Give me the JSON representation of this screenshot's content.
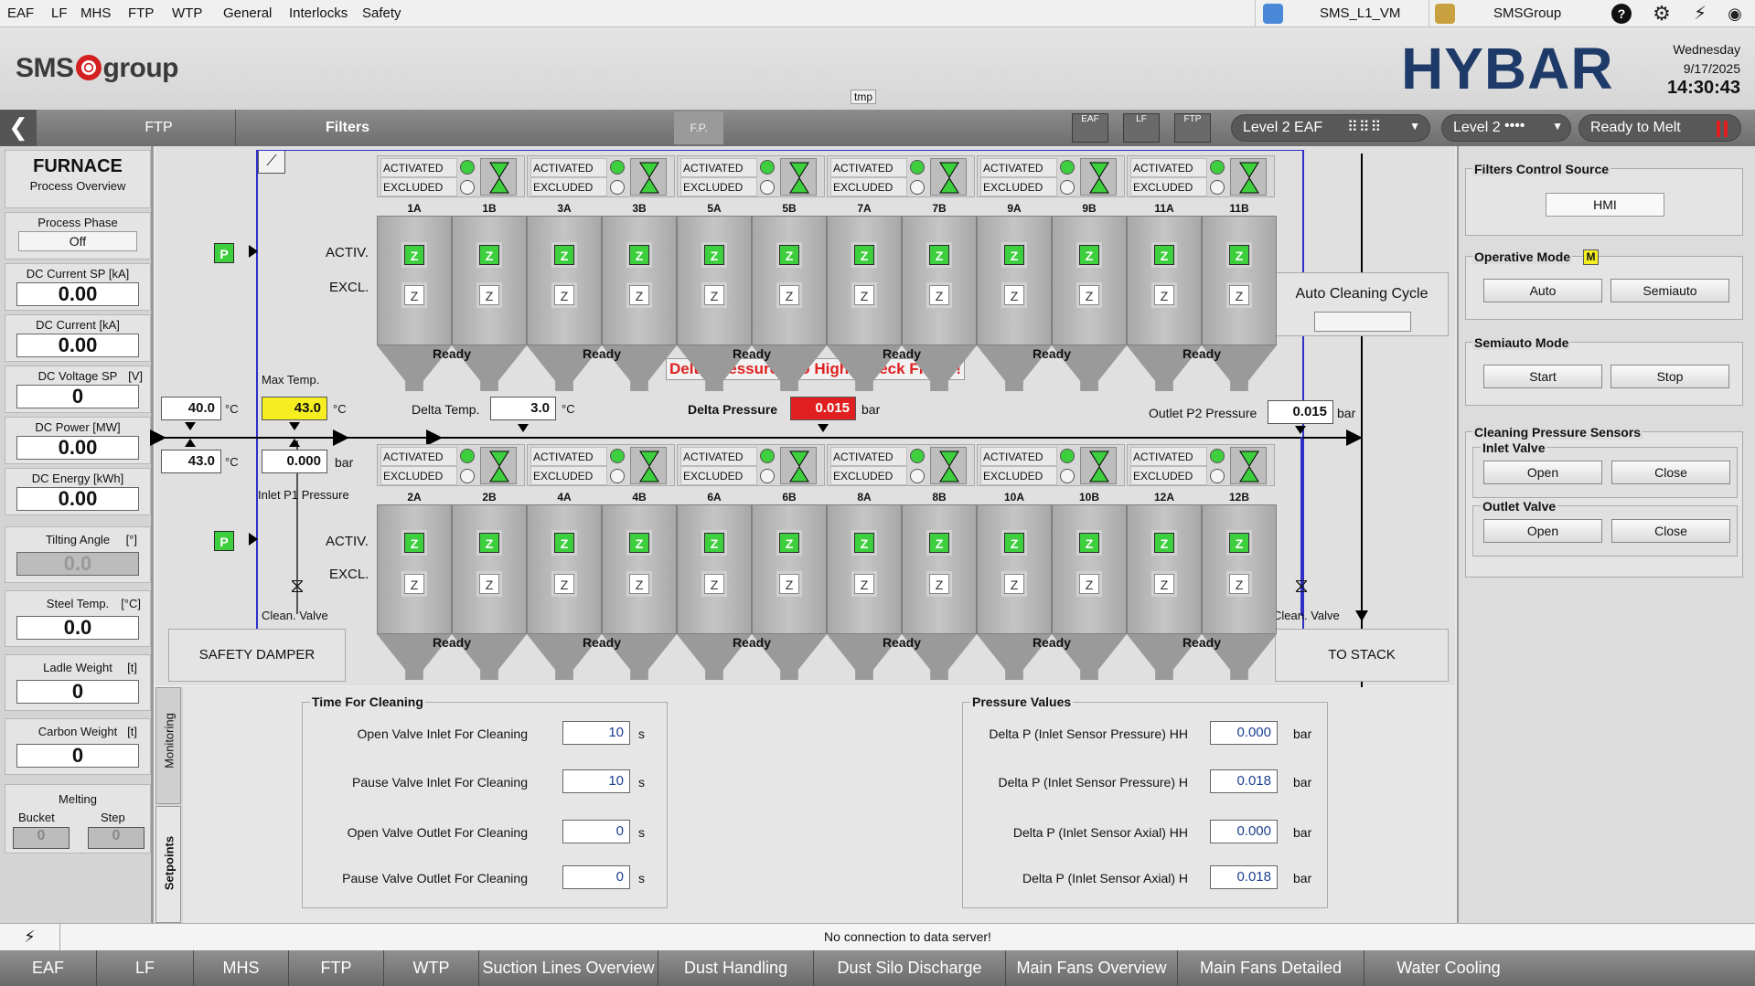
{
  "menu": {
    "items": [
      "EAF",
      "LF",
      "MHS",
      "FTP",
      "WTP",
      "General",
      "Interlocks",
      "Safety"
    ],
    "vm": "SMS_L1_VM",
    "group": "SMSGroup"
  },
  "header": {
    "logo_left": "SMS",
    "logo_right": "group",
    "brand": "HYBAR",
    "day": "Wednesday",
    "date": "9/17/2025",
    "time": "14:30:43",
    "tmp": "tmp"
  },
  "nav": {
    "crumb1": "FTP",
    "crumb2": "Filters",
    "fp": "F.P.",
    "level2_eaf": "Level 2 EAF",
    "level2": "Level 2",
    "ready": "Ready to Melt",
    "icons": [
      "EAF",
      "LF",
      "FTP"
    ]
  },
  "left": {
    "title": "FURNACE",
    "subtitle": "Process Overview",
    "process_phase": {
      "label": "Process Phase",
      "value": "Off"
    },
    "dc_current_sp": {
      "label": "DC Current SP [kA]",
      "value": "0.00"
    },
    "dc_current": {
      "label": "DC Current [kA]",
      "value": "0.00"
    },
    "dc_voltage_sp": {
      "label": "DC Voltage SP",
      "unit": "[V]",
      "value": "0"
    },
    "dc_power": {
      "label": "DC Power [MW]",
      "value": "0.00"
    },
    "dc_energy": {
      "label": "DC Energy [kWh]",
      "value": "0.00"
    },
    "tilting": {
      "label": "Tilting Angle",
      "unit": "[°]",
      "value": "0.0"
    },
    "steel_temp": {
      "label": "Steel Temp.",
      "unit": "[°C]",
      "value": "0.0"
    },
    "ladle": {
      "label": "Ladle Weight",
      "unit": "[t]",
      "value": "0"
    },
    "carbon": {
      "label": "Carbon Weight",
      "unit": "[t]",
      "value": "0"
    },
    "melting": {
      "label": "Melting",
      "bucket": "Bucket",
      "step": "Step",
      "bucket_val": "0",
      "step_val": "0"
    }
  },
  "filters": {
    "activated": "ACTIVATED",
    "excluded": "EXCLUDED",
    "activ": "ACTIV.",
    "excl": "EXCL.",
    "z": "Z",
    "p": "P",
    "ready": "Ready",
    "top_cells": [
      "1A",
      "1B",
      "3A",
      "3B",
      "5A",
      "5B",
      "7A",
      "7B",
      "9A",
      "9B",
      "11A",
      "11B"
    ],
    "bottom_cells": [
      "2A",
      "2B",
      "4A",
      "4B",
      "6A",
      "6B",
      "8A",
      "8B",
      "10A",
      "10B",
      "12A",
      "12B"
    ]
  },
  "process": {
    "alarm": "Delta Pressure Too High! Check Filters!",
    "temp_in_top": "40.0",
    "temp_in_bottom": "43.0",
    "deg_c": "°C",
    "max_temp_label": "Max Temp.",
    "max_temp": "43.0",
    "inlet_p1": "0.000",
    "inlet_p1_label": "Inlet P1 Pressure",
    "bar": "bar",
    "delta_temp_label": "Delta Temp.",
    "delta_temp": "3.0",
    "delta_p_label": "Delta Pressure",
    "delta_p": "0.015",
    "outlet_p2_label": "Outlet P2 Pressure",
    "outlet_p2": "0.015",
    "clean_valve": "Clean. Valve",
    "safety_damper": "SAFETY DAMPER",
    "to_stack": "TO STACK",
    "auto_cleaning": "Auto Cleaning Cycle"
  },
  "right": {
    "control_source_title": "Filters Control Source",
    "control_source": "HMI",
    "operative_title": "Operative Mode",
    "operative_badge": "M",
    "auto": "Auto",
    "semiauto": "Semiauto",
    "semiauto_title": "Semiauto Mode",
    "start": "Start",
    "stop": "Stop",
    "sensors_title": "Cleaning Pressure Sensors",
    "inlet_title": "Inlet Valve",
    "outlet_title": "Outlet Valve",
    "open": "Open",
    "close": "Close"
  },
  "tabs_vertical": {
    "monitoring": "Monitoring",
    "setpoints": "Setpoints"
  },
  "cleaning": {
    "title": "Time For Cleaning",
    "rows": [
      {
        "label": "Open Valve Inlet For Cleaning",
        "value": "10",
        "unit": "s"
      },
      {
        "label": "Pause Valve Inlet For Cleaning",
        "value": "10",
        "unit": "s"
      },
      {
        "label": "Open Valve Outlet For Cleaning",
        "value": "0",
        "unit": "s"
      },
      {
        "label": "Pause Valve Outlet For Cleaning",
        "value": "0",
        "unit": "s"
      }
    ]
  },
  "pressure": {
    "title": "Pressure Values",
    "rows": [
      {
        "label": "Delta P (Inlet Sensor Pressure) HH",
        "value": "0.000",
        "unit": "bar"
      },
      {
        "label": "Delta P (Inlet Sensor Pressure) H",
        "value": "0.018",
        "unit": "bar"
      },
      {
        "label": "Delta P (Inlet Sensor Axial) HH",
        "value": "0.000",
        "unit": "bar"
      },
      {
        "label": "Delta P (Inlet Sensor Axial) H",
        "value": "0.018",
        "unit": "bar"
      }
    ]
  },
  "status": {
    "message": "No connection to data server!"
  },
  "bottom_tabs": [
    "EAF",
    "LF",
    "MHS",
    "FTP",
    "WTP",
    "Suction Lines Overview",
    "Dust Handling",
    "Dust Silo Discharge",
    "Main Fans Overview",
    "Main Fans Detailed",
    "Water Cooling"
  ],
  "colors": {
    "green": "#3ecf3e",
    "alarm_red": "#e02020",
    "value_yellow": "#f5ee20",
    "value_red": "#e02020",
    "brand_blue": "#1e3a68"
  }
}
